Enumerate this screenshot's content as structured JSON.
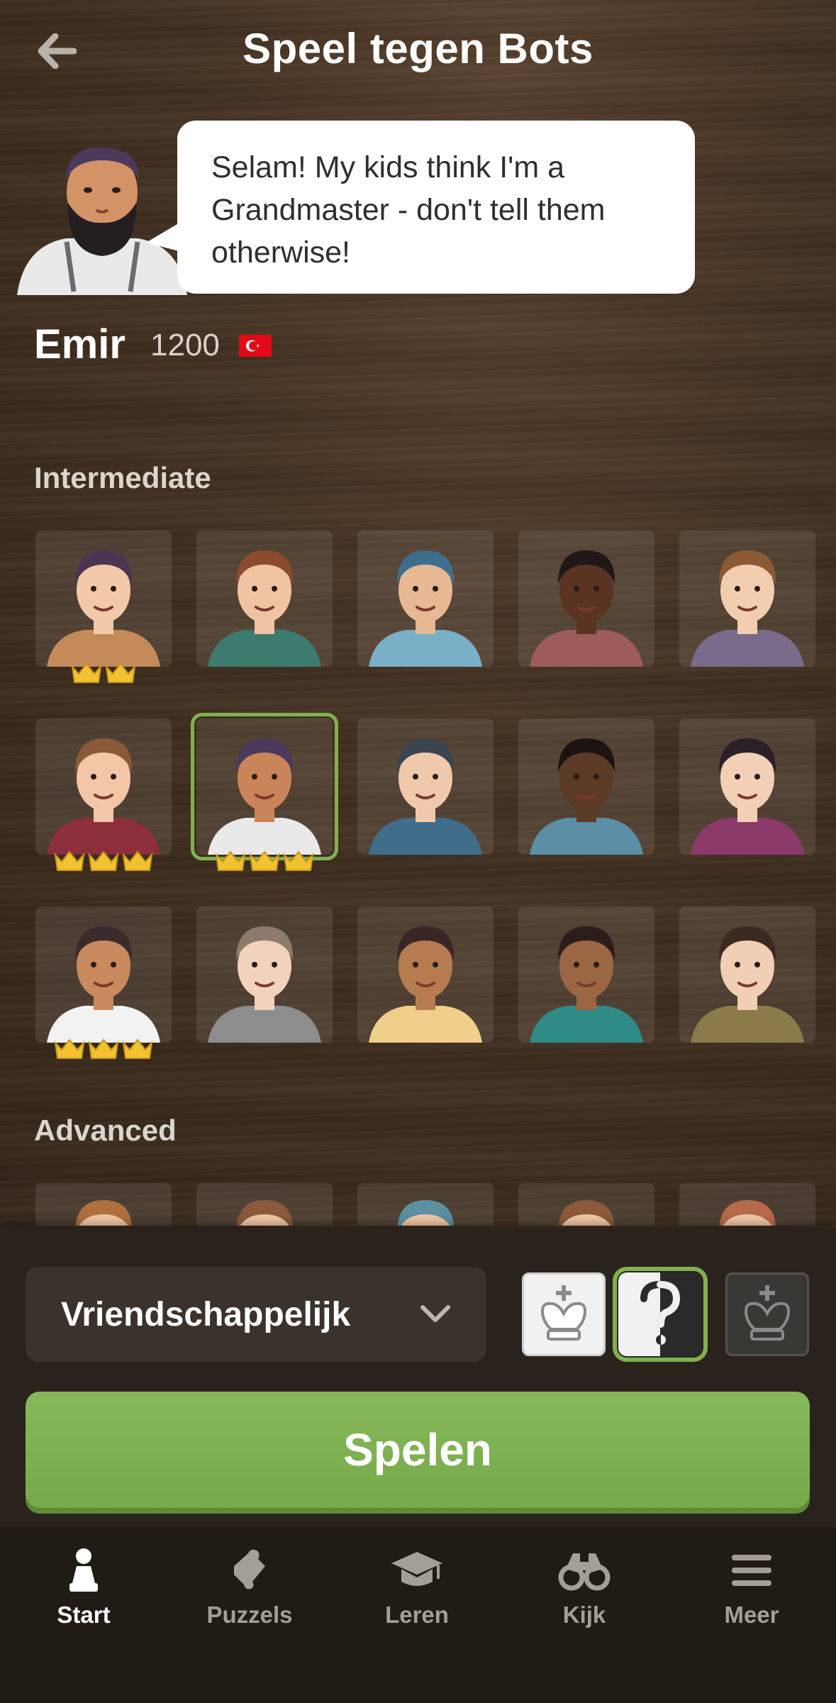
{
  "header": {
    "title": "Speel tegen Bots",
    "back_icon": "arrow-left-icon"
  },
  "featured_bot": {
    "speech": "Selam! My kids think I'm a Grandmaster - don't tell them otherwise!",
    "name": "Emir",
    "rating": "1200",
    "flag": "turkey-flag-icon"
  },
  "sections": {
    "intermediate": "Intermediate",
    "advanced": "Advanced"
  },
  "bots": [
    {
      "name": "bot-1",
      "crowns": 2,
      "selected": false
    },
    {
      "name": "bot-2",
      "crowns": 0,
      "selected": false
    },
    {
      "name": "bot-3",
      "crowns": 0,
      "selected": false
    },
    {
      "name": "bot-4",
      "crowns": 0,
      "selected": false
    },
    {
      "name": "bot-5",
      "crowns": 0,
      "selected": false
    },
    {
      "name": "bot-6",
      "crowns": 3,
      "selected": false
    },
    {
      "name": "bot-emir",
      "crowns": 3,
      "selected": true
    },
    {
      "name": "bot-8",
      "crowns": 0,
      "selected": false
    },
    {
      "name": "bot-9",
      "crowns": 0,
      "selected": false
    },
    {
      "name": "bot-10",
      "crowns": 0,
      "selected": false
    },
    {
      "name": "bot-11",
      "crowns": 3,
      "selected": false
    },
    {
      "name": "bot-12",
      "crowns": 0,
      "selected": false
    },
    {
      "name": "bot-13",
      "crowns": 0,
      "selected": false
    },
    {
      "name": "bot-14",
      "crowns": 0,
      "selected": false
    },
    {
      "name": "bot-15",
      "crowns": 0,
      "selected": false
    }
  ],
  "controls": {
    "mode": "Vriendschappelijk",
    "mode_icon": "chevron-down-icon",
    "color_options": [
      "white-king-icon",
      "random-question-icon",
      "black-king-icon"
    ],
    "selected_color": "random",
    "play_label": "Spelen",
    "accent": "#7fb14f"
  },
  "nav": {
    "items": [
      {
        "label": "Start",
        "icon": "pawn-icon",
        "active": true
      },
      {
        "label": "Puzzels",
        "icon": "puzzle-icon",
        "active": false
      },
      {
        "label": "Leren",
        "icon": "graduation-cap-icon",
        "active": false
      },
      {
        "label": "Kijk",
        "icon": "binoculars-icon",
        "active": false
      },
      {
        "label": "Meer",
        "icon": "menu-icon",
        "active": false
      }
    ]
  }
}
